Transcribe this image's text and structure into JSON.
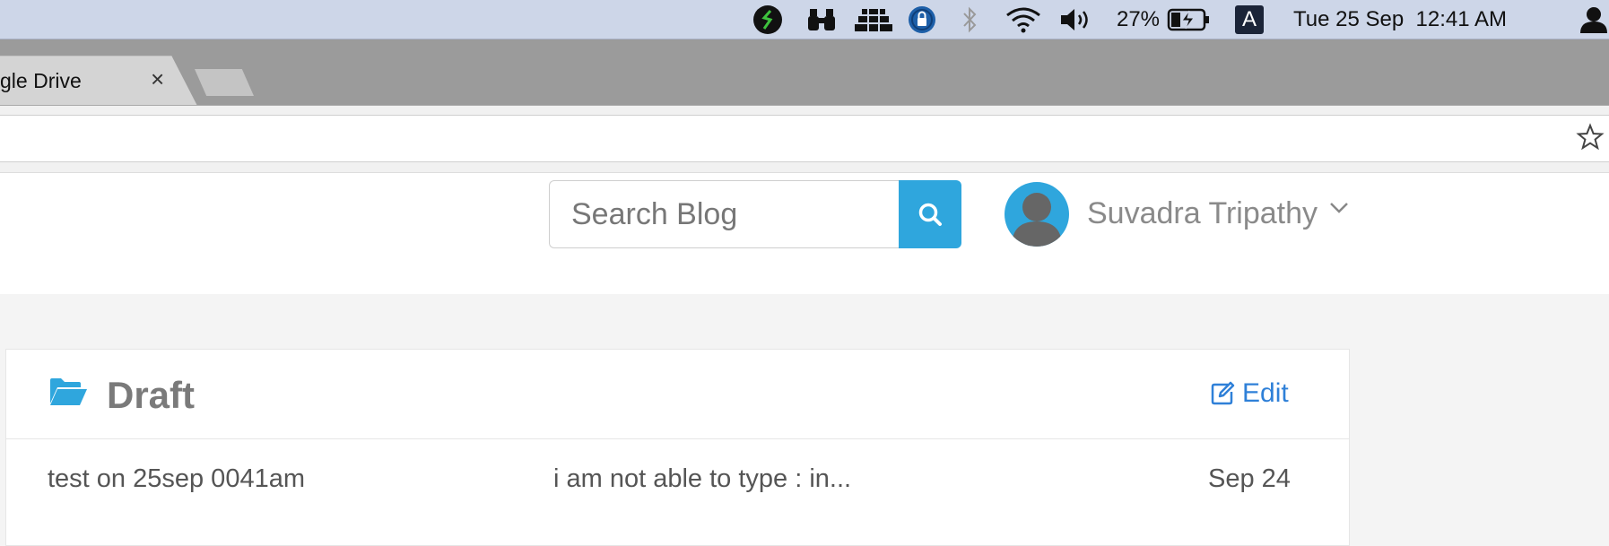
{
  "menubar": {
    "icons": [
      "sketchbook-icon",
      "binoculars-icon",
      "stack-icon",
      "password-lock-icon",
      "bluetooth-icon",
      "wifi-icon",
      "volume-icon",
      "battery-charging-icon",
      "input-source-icon",
      "user-icon"
    ],
    "battery_percent": "27%",
    "input_source": "A",
    "clock": "Tue 25 Sep  12:41 AM"
  },
  "browser": {
    "tab_title": "gle Drive",
    "tab_close": "×"
  },
  "header": {
    "search_placeholder": "Search Blog",
    "user_name": "Suvadra Tripathy"
  },
  "draft": {
    "title": "Draft",
    "edit_label": "Edit",
    "rows": [
      {
        "title": "test on 25sep 0041am",
        "excerpt": "i am not able to type : in...",
        "date": "Sep 24"
      }
    ]
  },
  "colors": {
    "accent": "#2fa6dd",
    "link": "#2f80d8",
    "menubar_bg": "#cdd6e8",
    "tabstrip_bg": "#9b9b9b"
  }
}
